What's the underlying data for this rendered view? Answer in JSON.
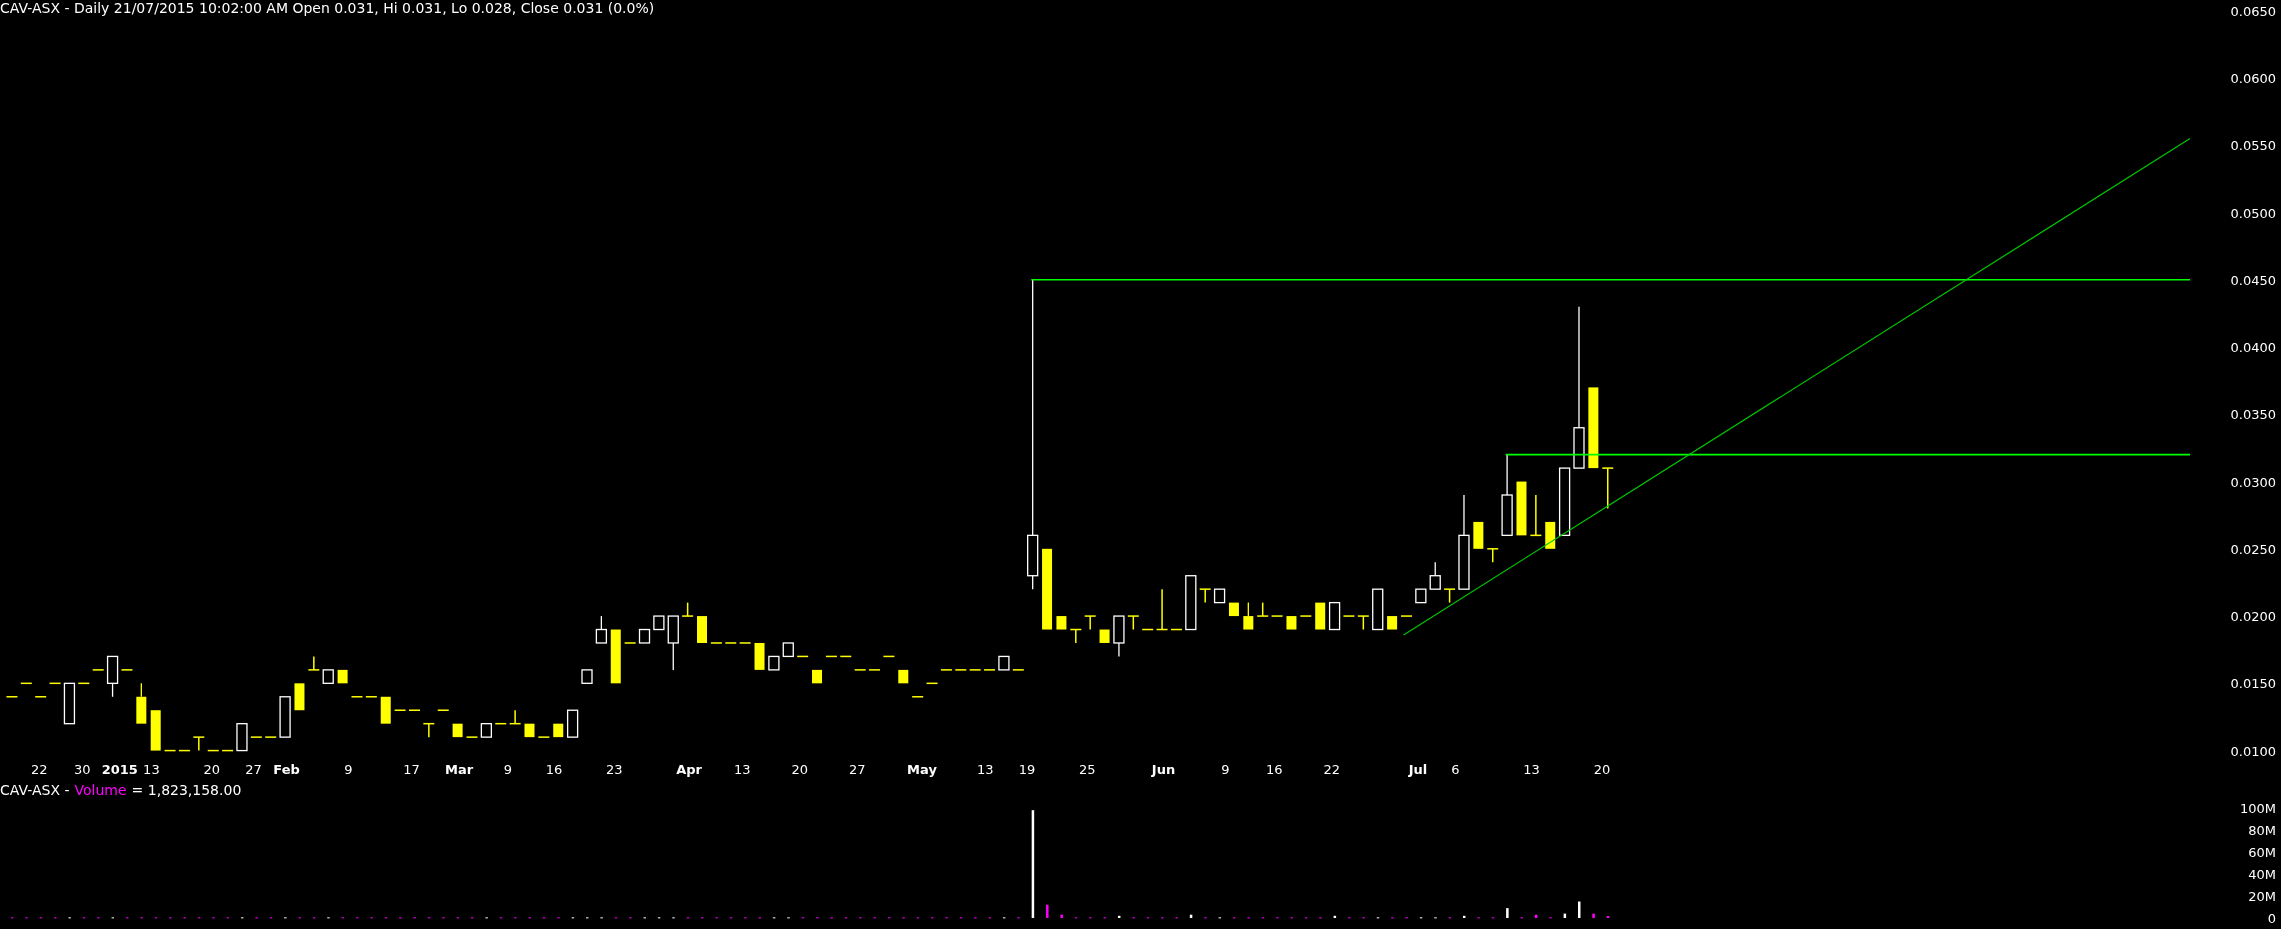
{
  "price_panel": {
    "header": "CAV-ASX - Daily 21/07/2015 10:02:00 AM Open 0.031, Hi 0.031, Lo 0.028, Close 0.031 (0.0%)",
    "y_axis_labels": [
      "0.0650",
      "0.0600",
      "0.0550",
      "0.0500",
      "0.0450",
      "0.0400",
      "0.0350",
      "0.0300",
      "0.0250",
      "0.0200",
      "0.0150",
      "0.0100"
    ],
    "x_axis_labels": [
      {
        "label": "22",
        "bold": false
      },
      {
        "label": "30",
        "bold": false
      },
      {
        "label": "2015",
        "bold": true
      },
      {
        "label": "13",
        "bold": false
      },
      {
        "label": "20",
        "bold": false
      },
      {
        "label": "27",
        "bold": false
      },
      {
        "label": "Feb",
        "bold": true
      },
      {
        "label": "9",
        "bold": false
      },
      {
        "label": "17",
        "bold": false
      },
      {
        "label": "Mar",
        "bold": true
      },
      {
        "label": "9",
        "bold": false
      },
      {
        "label": "16",
        "bold": false
      },
      {
        "label": "23",
        "bold": false
      },
      {
        "label": "Apr",
        "bold": true
      },
      {
        "label": "13",
        "bold": false
      },
      {
        "label": "20",
        "bold": false
      },
      {
        "label": "27",
        "bold": false
      },
      {
        "label": "May",
        "bold": true
      },
      {
        "label": "13",
        "bold": false
      },
      {
        "label": "19",
        "bold": false
      },
      {
        "label": "25",
        "bold": false
      },
      {
        "label": "Jun",
        "bold": true
      },
      {
        "label": "9",
        "bold": false
      },
      {
        "label": "16",
        "bold": false
      },
      {
        "label": "22",
        "bold": false
      },
      {
        "label": "Jul",
        "bold": true
      },
      {
        "label": "6",
        "bold": false
      },
      {
        "label": "13",
        "bold": false
      },
      {
        "label": "20",
        "bold": false
      }
    ]
  },
  "volume_panel": {
    "header": {
      "symbol": "CAV-ASX -",
      "label": "Volume",
      "value": "= 1,823,158.00"
    },
    "y_axis_labels": [
      "100M",
      "80M",
      "60M",
      "40M",
      "20M",
      "0"
    ]
  }
}
